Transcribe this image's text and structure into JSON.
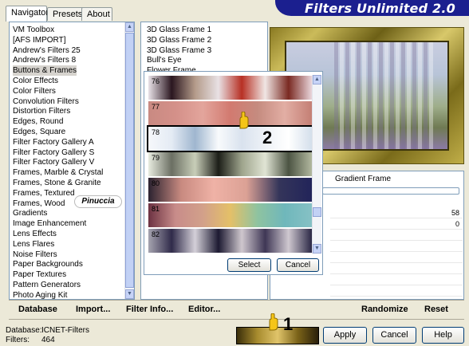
{
  "app": {
    "title": "Filters Unlimited 2.0"
  },
  "tabs": [
    "Navigator",
    "Presets",
    "About"
  ],
  "categories": [
    "VM Toolbox",
    "[AFS IMPORT]",
    "Andrew's Filters 25",
    "Andrew's Filters 8",
    "Buttons & Frames",
    "Color Effects",
    "Color Filters",
    "Convolution Filters",
    "Distortion Filters",
    "Edges, Round",
    "Edges, Square",
    "Filter Factory Gallery A",
    "Filter Factory Gallery S",
    "Filter Factory Gallery V",
    "Frames, Marble & Crystal",
    "Frames, Stone & Granite",
    "Frames, Textured",
    "Frames, Wood",
    "Gradients",
    "Image Enhancement",
    "Lens Effects",
    "Lens Flares",
    "Noise Filters",
    "Paper Backgrounds",
    "Paper Textures",
    "Pattern Generators",
    "Photo Aging Kit"
  ],
  "selected_category_index": 4,
  "filters": [
    "3D Glass Frame 1",
    "3D Glass Frame 2",
    "3D Glass Frame 3",
    "Bull's Eye",
    "Flower Frame"
  ],
  "gradients": [
    {
      "num": "76",
      "colors": [
        "#e9e2e8",
        "#2b1720",
        "#b49b8a",
        "#e8e1e4",
        "#b73024",
        "#f0e6e4",
        "#7a2a22",
        "#ead6dc"
      ]
    },
    {
      "num": "77",
      "colors": [
        "#c98a82",
        "#d49089",
        "#e3a59c",
        "#d27a70",
        "#c58b7f",
        "#e2aea4",
        "#c47f74"
      ]
    },
    {
      "num": "78",
      "colors": [
        "#f6f8fb",
        "#e4ebf4",
        "#9fb6cf",
        "#f8fafc",
        "#d9e2ee",
        "#eef2f7",
        "#ffffff",
        "#d4dfeb"
      ]
    },
    {
      "num": "79",
      "colors": [
        "#e8ece0",
        "#6b6f63",
        "#c8ceb8",
        "#1c1e18",
        "#9ea48c",
        "#e0e4d4",
        "#4c5443",
        "#b2b89f"
      ]
    },
    {
      "num": "80",
      "colors": [
        "#2b2230",
        "#c88a80",
        "#efb2a6",
        "#dba195",
        "#34355a",
        "#22245a"
      ]
    },
    {
      "num": "81",
      "colors": [
        "#6c3242",
        "#c88c8a",
        "#d2a08a",
        "#e4c068",
        "#8fc3a0",
        "#6fb7bb",
        "#86c1c5"
      ]
    },
    {
      "num": "82",
      "colors": [
        "#a6a4b0",
        "#302b4a",
        "#d4d0d8",
        "#1d1a32",
        "#cfc7ce",
        "#3f3755",
        "#cfc8d0",
        "#2a2745"
      ]
    }
  ],
  "popup": {
    "select_label": "Select",
    "cancel_label": "Cancel"
  },
  "annotations": {
    "pinuccia": "Pinuccia",
    "step1": "1",
    "step2": "2"
  },
  "params": {
    "title": "Gradient Frame",
    "value1": "58",
    "value2": "0"
  },
  "toolbar": {
    "database": "Database",
    "import": "Import...",
    "filter_info": "Filter Info...",
    "editor": "Editor...",
    "randomize": "Randomize",
    "reset": "Reset"
  },
  "status": {
    "database_label": "Database:",
    "database_value": "ICNET-Filters",
    "filters_label": "Filters:",
    "filters_value": "464"
  },
  "buttons": {
    "apply": "Apply",
    "cancel": "Cancel",
    "help": "Help"
  },
  "colors": {
    "banner": "#1b1f8f",
    "accent_yellow": "#f5c518"
  }
}
